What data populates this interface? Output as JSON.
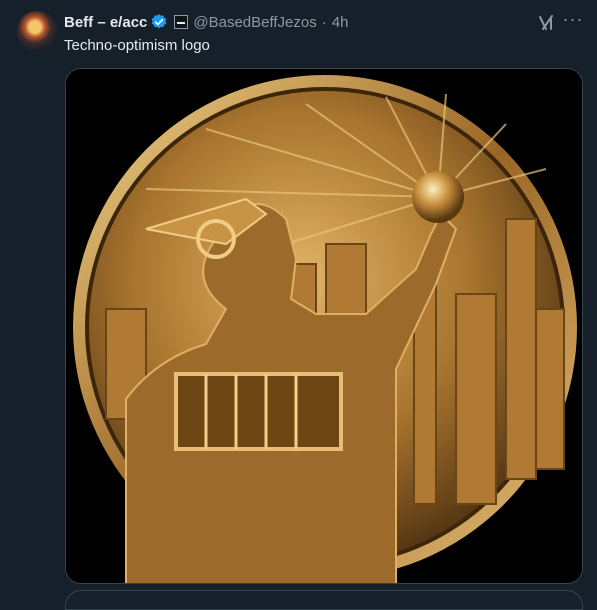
{
  "tweet": {
    "author_name": "Beff – e/acc",
    "handle": "@BasedBeffJezos",
    "separator": "·",
    "time": "4h",
    "text": "Techno-optimism logo",
    "verified": true,
    "avatar": "avatar-image"
  },
  "actions": {
    "grok_icon": "grok-icon",
    "more_icon": "more-options-icon"
  },
  "media": {
    "alt": "gold-medallion-image"
  },
  "colors": {
    "background": "#15202b",
    "text": "#e7e9ea",
    "secondary_text": "#8b98a5",
    "verified_blue": "#1d9bf0",
    "border": "#38444d",
    "gold": "#c9973f"
  }
}
